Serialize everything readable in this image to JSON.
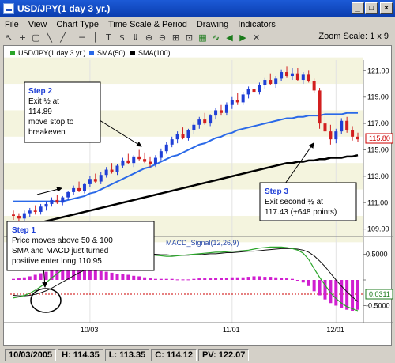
{
  "window": {
    "title": "USD/JPY(1 day  3 yr.)",
    "minimize": "_",
    "maximize": "□",
    "close": "×"
  },
  "menu": [
    "File",
    "View",
    "Chart Type",
    "Time Scale & Period",
    "Drawing",
    "Indicators"
  ],
  "toolbar": {
    "icons": [
      "arrow-cursor-icon",
      "crosshair-icon",
      "rectangle-icon",
      "line-tool-icon",
      "line-tool-icon-2",
      "horizontal-line-icon",
      "vertical-line-icon",
      "text-tool-icon",
      "dollar-icon",
      "down-arrow-icon",
      "zoom-in-icon",
      "zoom-out-icon",
      "zoom-fit-icon",
      "zoom-range-icon",
      "grid-icon",
      "trend-icon",
      "scroll-left-icon",
      "scroll-right-icon",
      "erase-icon"
    ],
    "zoom_label": "Zoom Scale: 1 x 9"
  },
  "legend": {
    "price": "USD/JPY(1 day  3 yr.)",
    "sma50": "SMA(50)",
    "sma100": "SMA(100)",
    "macd_signal": "MACD_Signal(12,26,9)"
  },
  "colors": {
    "up": "#1f3fd6",
    "down": "#d21f1f",
    "sma50": "#2a69e8",
    "sma100": "#000000",
    "macd": "#2aa52a",
    "signal": "#111111",
    "hist": "#d01fd0",
    "band": "#f4f4de"
  },
  "annotations": {
    "step2": {
      "title": "Step 2",
      "lines": [
        "Exit ½ at",
        "114.89",
        "move stop to",
        "breakeven"
      ]
    },
    "step3": {
      "title": "Step 3",
      "lines": [
        "Exit second ½ at",
        "117.43 (+648 points)"
      ]
    },
    "step1": {
      "title": "Step 1",
      "lines": [
        "Price moves above 50 & 100",
        "SMA and MACD just turned",
        "positive enter long 110.95"
      ]
    }
  },
  "chart_data": {
    "type": "candlestick",
    "price_axis": {
      "ticks": [
        "121.00",
        "119.00",
        "117.00",
        "115.00",
        "113.00",
        "111.00",
        "109.00"
      ],
      "ylim": [
        108.5,
        121.8
      ],
      "current_value": "115.80"
    },
    "macd_axis": {
      "ticks": [
        "0.5000",
        "0.0000",
        "-0.5000"
      ],
      "ylim": [
        -0.8,
        0.8
      ],
      "current_value": "0.0311"
    },
    "x_labels": [
      "10/03",
      "11/01",
      "12/01"
    ],
    "candles": [
      [
        110.1,
        110.4,
        109.7,
        110.0
      ],
      [
        110.0,
        110.2,
        109.5,
        109.8
      ],
      [
        109.8,
        110.4,
        109.6,
        110.2
      ],
      [
        110.2,
        110.6,
        109.9,
        110.4
      ],
      [
        110.4,
        110.8,
        110.1,
        110.3
      ],
      [
        110.3,
        110.9,
        110.1,
        110.7
      ],
      [
        110.7,
        111.1,
        110.4,
        110.9
      ],
      [
        110.9,
        111.4,
        110.7,
        111.2
      ],
      [
        111.2,
        111.6,
        110.9,
        111.0
      ],
      [
        111.0,
        111.5,
        110.8,
        111.4
      ],
      [
        111.4,
        111.9,
        111.2,
        111.8
      ],
      [
        111.8,
        112.3,
        111.6,
        112.1
      ],
      [
        112.1,
        112.6,
        111.8,
        111.9
      ],
      [
        111.9,
        112.5,
        111.7,
        112.4
      ],
      [
        112.4,
        113.0,
        112.2,
        112.8
      ],
      [
        112.8,
        113.2,
        112.5,
        112.6
      ],
      [
        112.6,
        113.3,
        112.4,
        113.1
      ],
      [
        113.1,
        113.7,
        112.9,
        113.5
      ],
      [
        113.5,
        114.0,
        113.2,
        113.3
      ],
      [
        113.3,
        113.9,
        113.1,
        113.8
      ],
      [
        113.8,
        114.4,
        113.6,
        114.2
      ],
      [
        114.2,
        114.7,
        113.9,
        114.0
      ],
      [
        114.0,
        114.6,
        113.7,
        114.5
      ],
      [
        114.5,
        115.0,
        114.2,
        114.3
      ],
      [
        114.3,
        114.8,
        114.0,
        114.1
      ],
      [
        114.1,
        114.5,
        113.7,
        113.9
      ],
      [
        113.9,
        114.6,
        113.7,
        114.4
      ],
      [
        114.4,
        115.1,
        114.2,
        114.9
      ],
      [
        114.9,
        115.6,
        114.7,
        115.4
      ],
      [
        115.4,
        116.0,
        115.2,
        115.8
      ],
      [
        115.8,
        116.4,
        115.5,
        116.2
      ],
      [
        116.2,
        116.7,
        115.8,
        115.9
      ],
      [
        115.9,
        116.6,
        115.7,
        116.5
      ],
      [
        116.5,
        117.1,
        116.2,
        116.9
      ],
      [
        116.9,
        117.5,
        116.6,
        117.3
      ],
      [
        117.3,
        117.8,
        116.9,
        117.0
      ],
      [
        117.0,
        117.7,
        116.8,
        117.6
      ],
      [
        117.6,
        118.2,
        117.3,
        118.0
      ],
      [
        118.0,
        118.4,
        117.6,
        117.8
      ],
      [
        117.8,
        118.6,
        117.6,
        118.4
      ],
      [
        118.4,
        119.0,
        118.1,
        118.8
      ],
      [
        118.8,
        119.3,
        118.4,
        118.6
      ],
      [
        118.6,
        119.4,
        118.4,
        119.2
      ],
      [
        119.2,
        119.8,
        118.9,
        119.6
      ],
      [
        119.6,
        120.0,
        119.2,
        119.4
      ],
      [
        119.4,
        120.1,
        119.2,
        119.9
      ],
      [
        119.9,
        120.5,
        119.6,
        120.3
      ],
      [
        120.3,
        120.8,
        119.9,
        120.0
      ],
      [
        120.0,
        120.6,
        119.7,
        120.4
      ],
      [
        120.4,
        121.1,
        120.2,
        120.9
      ],
      [
        120.9,
        121.3,
        120.5,
        120.6
      ],
      [
        120.6,
        121.2,
        120.3,
        120.8
      ],
      [
        120.8,
        121.2,
        120.2,
        120.3
      ],
      [
        120.3,
        120.9,
        120.0,
        120.7
      ],
      [
        120.7,
        121.0,
        120.1,
        120.2
      ],
      [
        120.2,
        120.4,
        119.3,
        119.5
      ],
      [
        119.5,
        119.7,
        116.6,
        117.0
      ],
      [
        117.0,
        117.6,
        116.3,
        116.4
      ],
      [
        116.4,
        116.9,
        115.4,
        115.8
      ],
      [
        115.8,
        116.6,
        115.5,
        116.4
      ],
      [
        116.4,
        117.4,
        116.2,
        117.2
      ],
      [
        117.2,
        117.5,
        116.3,
        116.5
      ],
      [
        116.5,
        116.8,
        115.7,
        116.0
      ],
      [
        116.0,
        116.3,
        115.6,
        115.8
      ]
    ],
    "sma50": [
      111.1,
      111.1,
      111.1,
      111.1,
      111.1,
      111.1,
      111.1,
      111.1,
      111.1,
      111.1,
      111.2,
      111.3,
      111.4,
      111.5,
      111.7,
      111.8,
      112.0,
      112.2,
      112.4,
      112.6,
      112.8,
      113.0,
      113.2,
      113.4,
      113.6,
      113.7,
      113.9,
      114.1,
      114.3,
      114.5,
      114.6,
      114.8,
      115.0,
      115.2,
      115.4,
      115.5,
      115.7,
      115.9,
      116.0,
      116.2,
      116.3,
      116.5,
      116.6,
      116.7,
      116.8,
      116.9,
      117.0,
      117.1,
      117.2,
      117.3,
      117.4,
      117.4,
      117.5,
      117.5,
      117.6,
      117.6,
      117.6,
      117.7,
      117.7,
      117.7,
      117.7,
      117.8,
      117.8,
      117.8
    ],
    "sma100": [
      109.0,
      109.1,
      109.2,
      109.3,
      109.4,
      109.5,
      109.6,
      109.7,
      109.8,
      109.9,
      110.0,
      110.1,
      110.2,
      110.3,
      110.4,
      110.5,
      110.6,
      110.7,
      110.8,
      110.9,
      111.0,
      111.1,
      111.2,
      111.3,
      111.4,
      111.5,
      111.6,
      111.7,
      111.8,
      111.9,
      112.0,
      112.1,
      112.2,
      112.3,
      112.4,
      112.5,
      112.6,
      112.7,
      112.8,
      112.9,
      113.0,
      113.1,
      113.2,
      113.3,
      113.4,
      113.5,
      113.6,
      113.7,
      113.8,
      113.9,
      114.0,
      114.0,
      114.1,
      114.1,
      114.2,
      114.2,
      114.3,
      114.3,
      114.4,
      114.4,
      114.4,
      114.5,
      114.5,
      114.6
    ],
    "macd": [
      -0.35,
      -0.33,
      -0.3,
      -0.26,
      -0.2,
      -0.13,
      -0.05,
      0.04,
      0.12,
      0.2,
      0.27,
      0.33,
      0.38,
      0.42,
      0.45,
      0.48,
      0.5,
      0.52,
      0.53,
      0.54,
      0.55,
      0.56,
      0.56,
      0.55,
      0.53,
      0.5,
      0.48,
      0.47,
      0.46,
      0.46,
      0.47,
      0.48,
      0.49,
      0.5,
      0.51,
      0.52,
      0.53,
      0.54,
      0.54,
      0.55,
      0.56,
      0.56,
      0.57,
      0.58,
      0.6,
      0.62,
      0.63,
      0.64,
      0.64,
      0.64,
      0.63,
      0.61,
      0.58,
      0.52,
      0.4,
      0.22,
      0.05,
      -0.1,
      -0.25,
      -0.36,
      -0.45,
      -0.52,
      -0.56,
      -0.6
    ],
    "signal": [
      -0.3,
      -0.31,
      -0.31,
      -0.3,
      -0.28,
      -0.25,
      -0.21,
      -0.16,
      -0.1,
      -0.04,
      0.02,
      0.08,
      0.14,
      0.19,
      0.24,
      0.28,
      0.32,
      0.36,
      0.39,
      0.42,
      0.44,
      0.46,
      0.48,
      0.49,
      0.5,
      0.5,
      0.5,
      0.49,
      0.49,
      0.48,
      0.48,
      0.48,
      0.48,
      0.49,
      0.49,
      0.5,
      0.51,
      0.51,
      0.52,
      0.53,
      0.53,
      0.54,
      0.55,
      0.56,
      0.56,
      0.57,
      0.58,
      0.59,
      0.6,
      0.61,
      0.61,
      0.61,
      0.6,
      0.58,
      0.54,
      0.47,
      0.37,
      0.26,
      0.13,
      0.0,
      -0.12,
      -0.23,
      -0.33,
      -0.42
    ],
    "hist": [
      0.02,
      0.03,
      0.05,
      0.07,
      0.1,
      0.13,
      0.16,
      0.2,
      0.22,
      0.24,
      0.24,
      0.23,
      0.21,
      0.2,
      0.19,
      0.18,
      0.17,
      0.16,
      0.14,
      0.12,
      0.11,
      0.1,
      0.08,
      0.07,
      0.05,
      0.03,
      0.02,
      0.02,
      0.02,
      0.02,
      0.01,
      0.01,
      0.01,
      0.02,
      0.03,
      0.03,
      0.03,
      0.04,
      0.04,
      0.04,
      0.05,
      0.05,
      0.05,
      0.06,
      0.07,
      0.07,
      0.06,
      0.06,
      0.05,
      0.04,
      0.03,
      0.02,
      0.0,
      -0.05,
      -0.12,
      -0.22,
      -0.3,
      -0.38,
      -0.45,
      -0.5,
      -0.55,
      -0.58,
      -0.6,
      -0.58
    ]
  },
  "status": {
    "date": "10/03/2005",
    "high": "H: 114.35",
    "low": "L: 113.35",
    "close": "C: 114.12",
    "pv": "PV: 122.07"
  }
}
